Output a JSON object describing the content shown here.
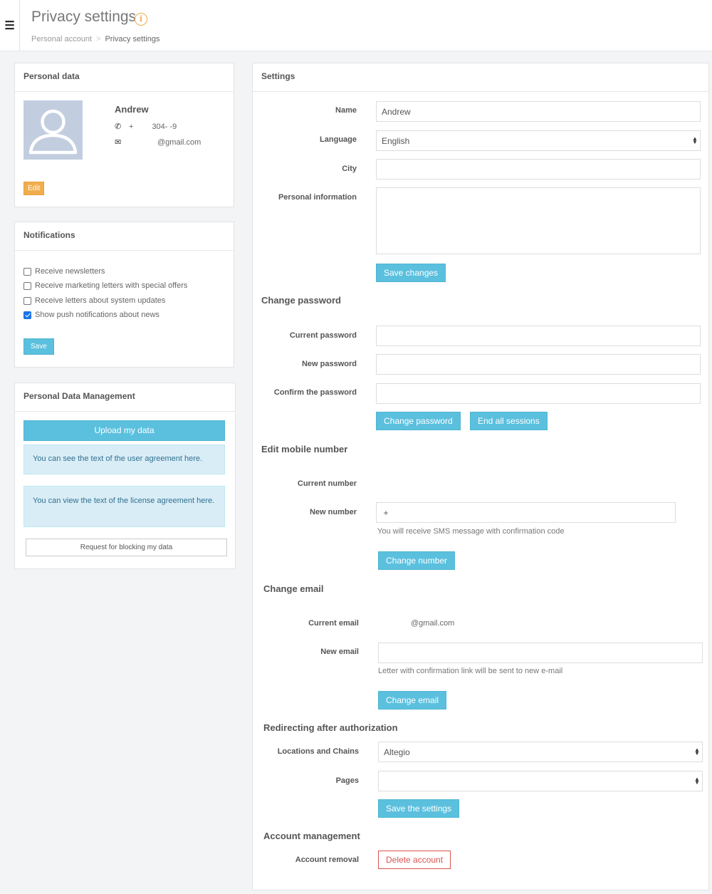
{
  "header": {
    "title": "Privacy settings",
    "info_icon": "i",
    "menu_icon": "☰",
    "breadcrumb": [
      "Personal account",
      "Privacy settings"
    ],
    "breadcrumb_sep": ">"
  },
  "personal_data": {
    "title": "Personal data",
    "name": "Andrew",
    "phone_icon": "✆",
    "phone_prefix": "+",
    "phone": "304-   -9",
    "email_icon": "✉",
    "email": "@gmail.com",
    "edit_label": "Edit"
  },
  "notifications": {
    "title": "Notifications",
    "items": [
      {
        "label": "Receive newsletters",
        "checked": false
      },
      {
        "label": "Receive marketing letters with special offers",
        "checked": false
      },
      {
        "label": "Receive letters about system updates",
        "checked": false
      },
      {
        "label": "Show push notifications about news",
        "checked": true
      }
    ],
    "save_label": "Save"
  },
  "pdm": {
    "title": "Personal Data Management",
    "upload_label": "Upload my data",
    "user_agreement": "You can see the text of the user agreement here.",
    "license_agreement": "You can view the text of the license agreement here.",
    "block_label": "Request for blocking my data"
  },
  "settings": {
    "title": "Settings",
    "name_label": "Name",
    "name_value": "Andrew",
    "language_label": "Language",
    "language_value": "English",
    "city_label": "City",
    "city_value": "",
    "personal_info_label": "Personal information",
    "personal_info_value": "",
    "save_changes": "Save changes",
    "change_password_title": "Change password",
    "current_password_label": "Current password",
    "new_password_label": "New password",
    "confirm_password_label": "Confirm the password",
    "change_password_btn": "Change password",
    "end_sessions_btn": "End all sessions",
    "edit_mobile_title": "Edit mobile number",
    "current_number_label": "Current number",
    "new_number_label": "New number",
    "number_prefix": "+",
    "sms_help": "You will receive SMS message with confirmation code",
    "change_number_btn": "Change number",
    "change_email_title": "Change email",
    "current_email_label": "Current email",
    "current_email_value": "@gmail.com",
    "new_email_label": "New email",
    "email_help": "Letter with confirmation link will be sent to new e-mail",
    "change_email_btn": "Change email",
    "redirect_title": "Redirecting after authorization",
    "locations_label": "Locations and Chains",
    "locations_value": "Altegio",
    "pages_label": "Pages",
    "pages_value": "",
    "save_settings_btn": "Save the settings",
    "account_mgmt_title": "Account management",
    "account_removal_label": "Account removal",
    "delete_account_btn": "Delete account"
  },
  "colors": {
    "primary": "#5bc0de",
    "warning": "#f0ad4e",
    "danger": "#d9534f",
    "checkbox": "#1a73e8"
  }
}
